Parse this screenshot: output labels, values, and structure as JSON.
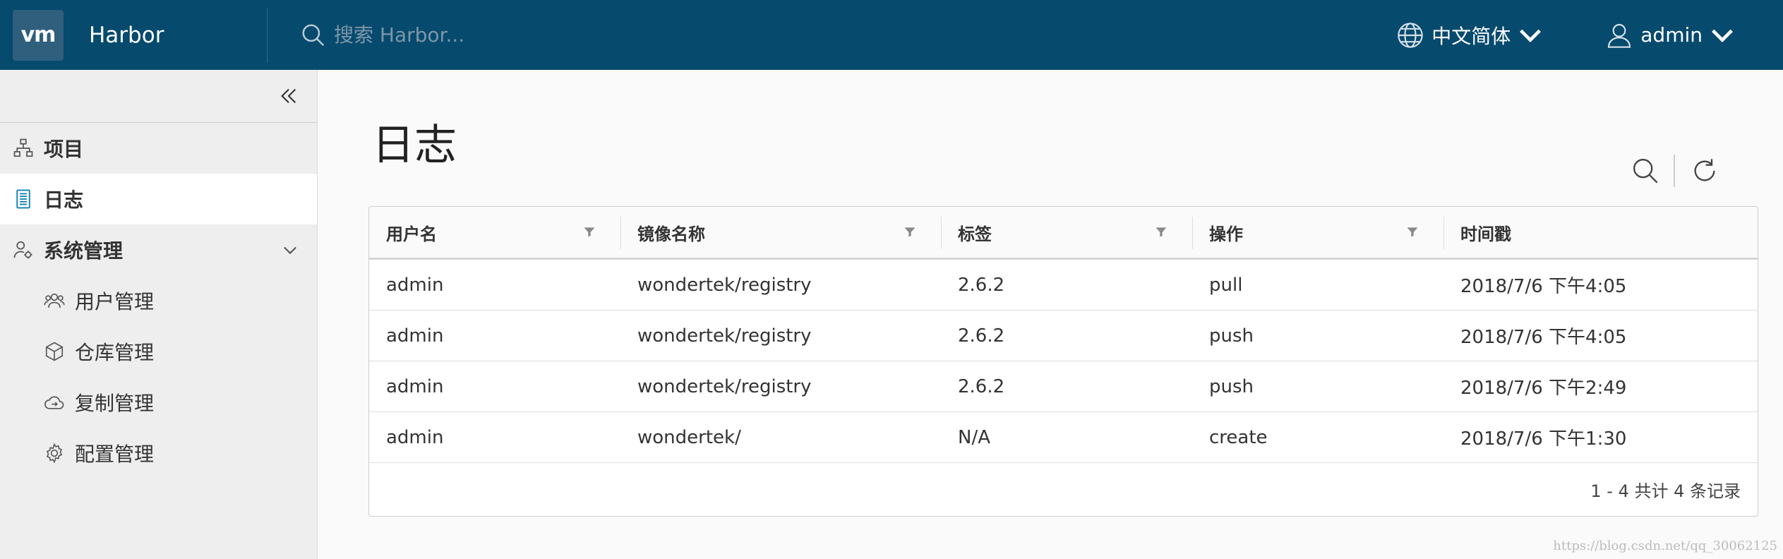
{
  "header": {
    "logo_text": "vm",
    "brand": "Harbor",
    "search_placeholder": "搜索 Harbor...",
    "language": "中文简体",
    "user": "admin"
  },
  "sidebar": {
    "items": [
      {
        "label": "项目",
        "icon": "projects-icon"
      },
      {
        "label": "日志",
        "icon": "logs-icon",
        "active": true
      },
      {
        "label": "系统管理",
        "icon": "admin-icon",
        "expanded": true
      }
    ],
    "sub_items": [
      {
        "label": "用户管理",
        "icon": "users-icon"
      },
      {
        "label": "仓库管理",
        "icon": "cube-icon"
      },
      {
        "label": "复制管理",
        "icon": "cloud-icon"
      },
      {
        "label": "配置管理",
        "icon": "gear-icon"
      }
    ]
  },
  "main": {
    "title": "日志",
    "columns": [
      "用户名",
      "镜像名称",
      "标签",
      "操作",
      "时间戳"
    ],
    "rows": [
      [
        "admin",
        "wondertek/registry",
        "2.6.2",
        "pull",
        "2018/7/6 下午4:05"
      ],
      [
        "admin",
        "wondertek/registry",
        "2.6.2",
        "push",
        "2018/7/6 下午4:05"
      ],
      [
        "admin",
        "wondertek/registry",
        "2.6.2",
        "push",
        "2018/7/6 下午2:49"
      ],
      [
        "admin",
        "wondertek/",
        "N/A",
        "create",
        "2018/7/6 下午1:30"
      ]
    ],
    "footer": "1 - 4 共计 4 条记录"
  },
  "watermark": "https://blog.csdn.net/qq_30062125",
  "colors": {
    "header_bg": "#064a6e",
    "sidebar_bg": "#eeeeee",
    "accent": "#0079b8"
  }
}
